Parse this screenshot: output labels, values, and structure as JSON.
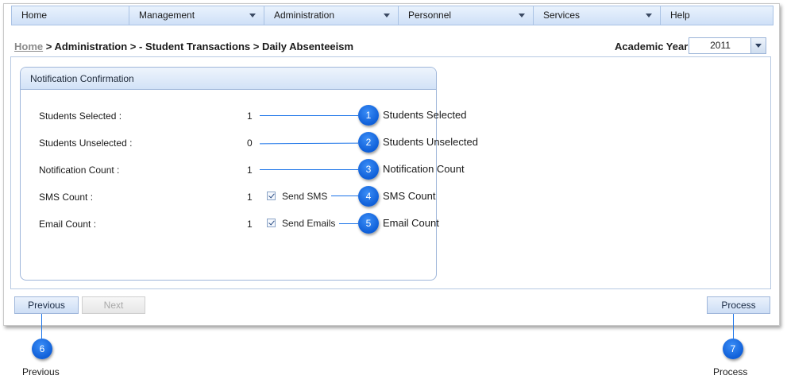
{
  "nav": {
    "items": [
      {
        "label": "Home",
        "dropdown": false
      },
      {
        "label": "Management",
        "dropdown": true
      },
      {
        "label": "Administration",
        "dropdown": true
      },
      {
        "label": "Personnel",
        "dropdown": true
      },
      {
        "label": "Services",
        "dropdown": true
      },
      {
        "label": "Help",
        "dropdown": false
      }
    ]
  },
  "breadcrumb": {
    "home": "Home",
    "path": " > Administration > - Student Transactions > Daily Absenteeism"
  },
  "academic_year": {
    "label": "Academic Year",
    "value": "2011"
  },
  "panel": {
    "title": "Notification Confirmation",
    "rows": [
      {
        "label": "Students Selected :",
        "value": "1"
      },
      {
        "label": "Students Unselected :",
        "value": "0"
      },
      {
        "label": "Notification Count :",
        "value": "1"
      },
      {
        "label": "SMS Count :",
        "value": "1",
        "checkbox_label": "Send SMS",
        "checked": true
      },
      {
        "label": "Email Count :",
        "value": "1",
        "checkbox_label": "Send Emails",
        "checked": true
      }
    ]
  },
  "callouts": [
    {
      "number": "1",
      "text": "Students Selected"
    },
    {
      "number": "2",
      "text": "Students Unselected"
    },
    {
      "number": "3",
      "text": "Notification Count"
    },
    {
      "number": "4",
      "text": "SMS Count"
    },
    {
      "number": "5",
      "text": "Email Count"
    },
    {
      "number": "6",
      "text": "Previous"
    },
    {
      "number": "7",
      "text": "Process"
    }
  ],
  "buttons": {
    "previous": "Previous",
    "next": "Next",
    "process": "Process"
  },
  "colors": {
    "callout": "#1a73e8",
    "nav_bg": "#d6e5f8"
  }
}
